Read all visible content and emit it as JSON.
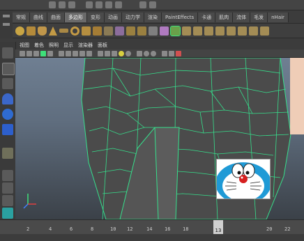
{
  "shelf": {
    "tabs": [
      {
        "label": "常规",
        "active": false
      },
      {
        "label": "曲线",
        "active": false
      },
      {
        "label": "曲面",
        "active": false
      },
      {
        "label": "多边形",
        "active": true
      },
      {
        "label": "变形",
        "active": false
      },
      {
        "label": "动画",
        "active": false
      },
      {
        "label": "动力学",
        "active": false
      },
      {
        "label": "渲染",
        "active": false
      },
      {
        "label": "PaintEffects",
        "active": false
      },
      {
        "label": "卡通",
        "active": false
      },
      {
        "label": "肌肉",
        "active": false
      },
      {
        "label": "流体",
        "active": false
      },
      {
        "label": "毛发",
        "active": false
      },
      {
        "label": "nHair",
        "active": false
      }
    ]
  },
  "panel_menu": {
    "items": [
      "视图",
      "着色",
      "照明",
      "显示",
      "渲染器",
      "面板"
    ]
  },
  "timeline": {
    "ticks": [
      "2",
      "4",
      "6",
      "8",
      "10",
      "12",
      "14",
      "16",
      "18",
      "20",
      "22"
    ],
    "current_frame": "13"
  },
  "colors": {
    "wire": "#36e08c",
    "face": "#4a4a4a",
    "accent_active_tab": "#6a6a6a"
  },
  "icons": {
    "axis_gizmo": "axis-icon"
  }
}
